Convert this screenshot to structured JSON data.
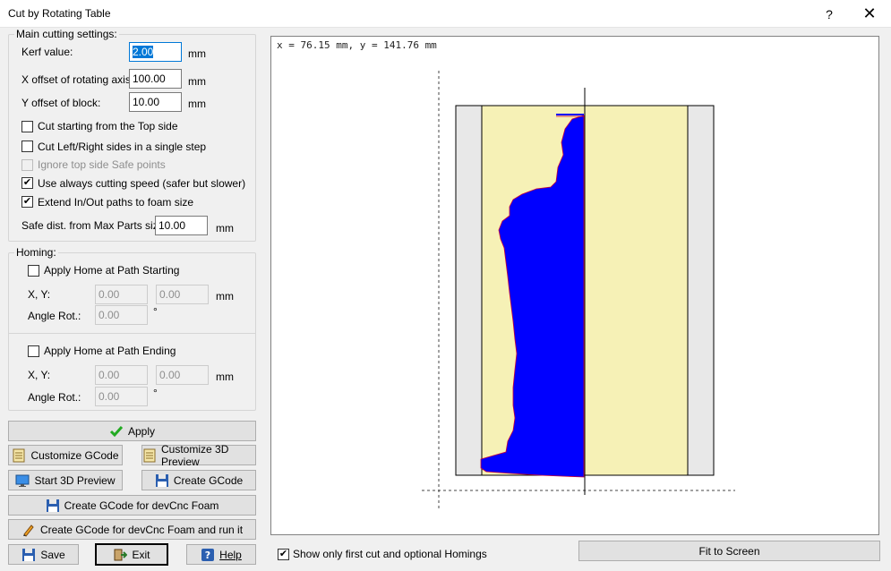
{
  "window": {
    "title": "Cut by Rotating Table",
    "help_glyph": "?",
    "close_glyph": "✕"
  },
  "main": {
    "legend": "Main cutting settings:",
    "kerf_label": "Kerf value:",
    "kerf_value": "2.00",
    "kerf_unit": "mm",
    "xoff_label": "X offset of rotating axis:",
    "xoff_value": "100.00",
    "xoff_unit": "mm",
    "yoff_label": "Y offset of block:",
    "yoff_value": "10.00",
    "yoff_unit": "mm",
    "opt_top": "Cut starting from the Top side",
    "opt_leftright": "Cut Left/Right sides in a single step",
    "opt_ignore": "Ignore top side Safe points",
    "opt_speed": "Use always cutting speed (safer but slower)",
    "opt_extend": "Extend In/Out paths to foam  size",
    "safe_label": "Safe dist. from Max Parts size:",
    "safe_value": "10.00",
    "safe_unit": "mm"
  },
  "homing": {
    "legend": "Homing:",
    "start_label": "Apply Home at Path Starting",
    "start_xy_label": "X, Y:",
    "start_x": "0.00",
    "start_y": "0.00",
    "start_unit": "mm",
    "start_angle_label": "Angle Rot.:",
    "start_angle": "0.00",
    "start_angle_unit": "°",
    "end_label": "Apply Home at Path Ending",
    "end_xy_label": "X, Y:",
    "end_x": "0.00",
    "end_y": "0.00",
    "end_unit": "mm",
    "end_angle_label": "Angle Rot.:",
    "end_angle": "0.00",
    "end_angle_unit": "°"
  },
  "buttons": {
    "apply": "Apply",
    "customize_gcode": "Customize GCode",
    "customize_3d": "Customize 3D Preview",
    "start_3d": "Start 3D Preview",
    "create_gcode": "Create GCode",
    "create_devcnc": "Create GCode for devCnc Foam",
    "create_devcnc_run": "Create GCode for devCnc Foam and run it",
    "save": "Save",
    "exit": "Exit",
    "help": "Help",
    "fit": "Fit to Screen"
  },
  "preview": {
    "coords": "x = 76.15 mm, y = 141.76 mm",
    "show_first_label": "Show only first cut and optional Homings"
  },
  "checks": {
    "opt_top": false,
    "opt_leftright": false,
    "opt_ignore": false,
    "opt_speed": true,
    "opt_extend": true,
    "home_start": false,
    "home_end": false,
    "show_first": true
  },
  "colors": {
    "foam": "#f6f1b6",
    "block_side": "#e8e8e8",
    "cut": "#0000ff",
    "accent": "#0078d7"
  },
  "icons": {
    "apply": "check-icon",
    "customize_gcode": "notepad-icon",
    "customize_3d": "notepad-icon",
    "start_3d": "monitor-icon",
    "create_gcode": "floppy-icon",
    "create_devcnc": "floppy-icon",
    "create_devcnc_run": "pencil-icon",
    "save": "floppy-icon",
    "exit": "exit-door-icon",
    "help": "help-icon"
  }
}
